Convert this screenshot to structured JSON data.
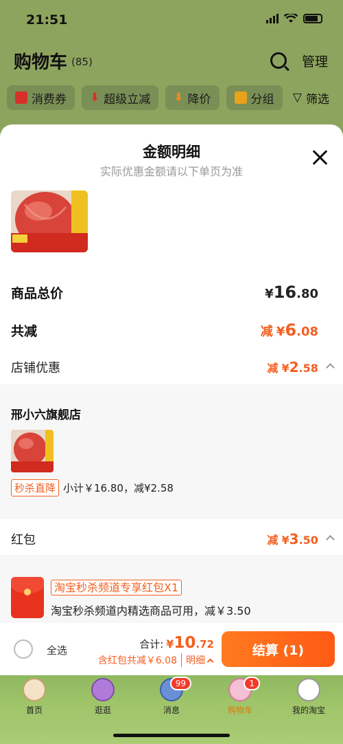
{
  "status_bar": {
    "time": "21:51"
  },
  "cart": {
    "title": "购物车",
    "count": "(85)",
    "manage": "管理",
    "filters": [
      "消费券",
      "超级立减",
      "降价",
      "分组"
    ],
    "filter_right": "筛选"
  },
  "sheet": {
    "title": "金额明细",
    "subtitle": "实际优惠金额请以下单页为准",
    "product_image_text": "条纹新鲜红富士 脆甜口#超值#精选烟台大果",
    "total_price": {
      "label": "商品总价",
      "yen": "¥",
      "int": "16",
      "dec": ".80"
    },
    "total_discount": {
      "label": "共减",
      "prefix": "减",
      "yen": "¥",
      "int": "6",
      "dec": ".08"
    },
    "store_discount": {
      "label": "店铺优惠",
      "prefix": "减",
      "yen": "¥",
      "int": "2",
      "dec": ".58"
    },
    "store": {
      "name": "邢小六旗舰店",
      "tag": "秒杀直降",
      "detail": "小计￥16.80，减¥2.58"
    },
    "red_packet": {
      "label": "红包",
      "prefix": "减",
      "yen": "¥",
      "int": "3",
      "dec": ".50",
      "item_title": "淘宝秒杀频道专享红包X1",
      "item_desc": "淘宝秒杀频道内精选商品可用，减￥3.50"
    }
  },
  "checkout": {
    "select_all": "全选",
    "total_label": "合计:",
    "total_yen": "¥",
    "total_int": "10",
    "total_dec": ".72",
    "red_line": "含红包共减￥6.08",
    "detail_link": "明细",
    "button": "结算 (1)"
  },
  "tabbar": {
    "items": [
      {
        "label": "首页"
      },
      {
        "label": "逛逛"
      },
      {
        "label": "消息",
        "badge": "99"
      },
      {
        "label": "购物车",
        "badge": "1"
      },
      {
        "label": "我的淘宝"
      }
    ]
  },
  "colors": {
    "accent": "#f35f20",
    "button": "#ff6a18",
    "tabbar": "#9fc46a"
  }
}
